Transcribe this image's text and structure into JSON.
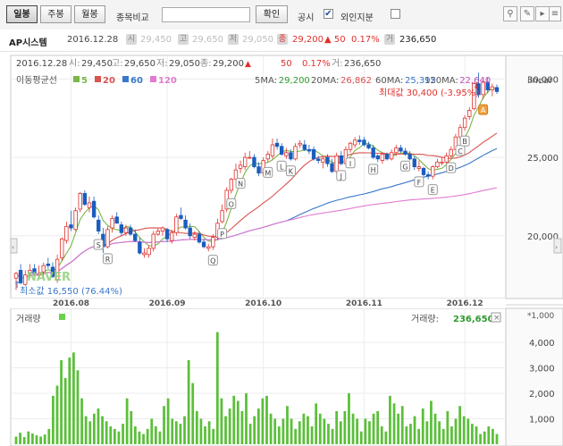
{
  "toolbar": {
    "tabs": [
      {
        "label": "일봉",
        "active": true
      },
      {
        "label": "주봉",
        "active": false
      },
      {
        "label": "월봉",
        "active": false
      }
    ],
    "compare_label": "종목비교",
    "compare_value": "",
    "confirm_label": "확인",
    "notice_label": "공시",
    "notice_checked": true,
    "foreign_label": "외인지분",
    "foreign_checked": false
  },
  "quote": {
    "name": "AP시스템",
    "date": "2016.12.28",
    "open": "29,450",
    "high": "29,650",
    "low": "29,050",
    "close": "29,200",
    "change": "▲ 50",
    "change_pct": "0.17%",
    "volume": "236,650"
  },
  "chart_data": [
    {
      "type": "line",
      "title": "",
      "info_line": {
        "date": "2016.12.28",
        "open_label": "시:",
        "open": "29,450",
        "high_label": "고:",
        "high": "29,650",
        "low_label": "저:",
        "low": "29,050",
        "close_label": "종:",
        "close": "29,200",
        "change_arrow": "▲",
        "change": "50",
        "change_pct": "0.17%",
        "volume_label": "거:",
        "volume": "236,650"
      },
      "legend_title": "이동평균선",
      "legend": [
        {
          "name": "5",
          "color": "#7ab648"
        },
        {
          "name": "20",
          "color": "#d9534f"
        },
        {
          "name": "60",
          "color": "#3a78c9"
        },
        {
          "name": "120",
          "color": "#e27bd0"
        }
      ],
      "ma_values": [
        {
          "label": "5MA:",
          "value": "29,200",
          "color": "#2e9a2e"
        },
        {
          "label": "20MA:",
          "value": "26,862",
          "color": "#d9534f"
        },
        {
          "label": "60MA:",
          "value": "25,395",
          "color": "#3a78c9"
        },
        {
          "label": "120MA:",
          "value": "22,640",
          "color": "#c050b8"
        }
      ],
      "scale_label": "linear",
      "max_label": "최대값 30,400 (-3.95%)",
      "min_label": "최소값 16,550 (76.44%)",
      "watermark": "NAVER",
      "x_ticks": [
        "2016.08",
        "2016.09",
        "2016.10",
        "2016.11",
        "2016.12"
      ],
      "x_tick_index": [
        12,
        33,
        54,
        76,
        98
      ],
      "y_ticks": [
        20000,
        25000,
        30000
      ],
      "y_tick_labels": [
        "20,000",
        "25,000",
        "30,000"
      ],
      "ylim": [
        16000,
        31500
      ],
      "grid": true,
      "candles": {
        "open": [
          17300,
          17800,
          16900,
          17600,
          17900,
          17500,
          17700,
          18200,
          18000,
          17200,
          18600,
          19700,
          20700,
          20400,
          21700,
          22700,
          21800,
          22200,
          21000,
          20100,
          19300,
          20500,
          21200,
          20700,
          20200,
          20500,
          20100,
          19600,
          18800,
          18800,
          19200,
          20100,
          20300,
          20400,
          19700,
          20200,
          21300,
          21000,
          20500,
          19900,
          20100,
          19600,
          19200,
          19300,
          19900,
          20900,
          21700,
          22900,
          23600,
          24300,
          24400,
          25000,
          25000,
          24400,
          24000,
          24900,
          25100,
          25900,
          25700,
          25100,
          25300,
          24900,
          25800,
          25800,
          25500,
          25500,
          24900,
          24700,
          25000,
          24600,
          24100,
          25100,
          24600,
          25500,
          25800,
          26100,
          26100,
          25800,
          25600,
          25100,
          24800,
          25200,
          24900,
          25300,
          25600,
          25400,
          25200,
          24900,
          24300,
          24300,
          23900,
          23800,
          24400,
          24700,
          24700,
          25100,
          25500,
          26300,
          26900,
          27600,
          28100,
          29700,
          29000,
          29800,
          29300,
          29450
        ],
        "high": [
          17700,
          18200,
          17800,
          18200,
          18200,
          18100,
          18300,
          18600,
          18300,
          18800,
          19900,
          20900,
          21600,
          21800,
          22800,
          22900,
          22500,
          22500,
          21300,
          20500,
          20600,
          21300,
          21500,
          20900,
          20700,
          20700,
          20400,
          19900,
          19200,
          19400,
          20300,
          20500,
          20600,
          20500,
          20400,
          21400,
          21800,
          21300,
          20800,
          20300,
          20300,
          19800,
          19500,
          20100,
          21100,
          22000,
          23100,
          23700,
          24600,
          24800,
          25300,
          25400,
          25200,
          24700,
          25000,
          25400,
          26200,
          26200,
          25900,
          25600,
          25500,
          25900,
          26100,
          26100,
          25800,
          25700,
          25100,
          25100,
          25200,
          24900,
          25300,
          25400,
          25700,
          26000,
          26300,
          26400,
          26300,
          26000,
          25800,
          25200,
          25300,
          25300,
          25500,
          25800,
          25800,
          25600,
          25400,
          25100,
          24800,
          24400,
          24100,
          24500,
          24900,
          25000,
          25300,
          25700,
          26500,
          27100,
          27700,
          28200,
          29800,
          30400,
          30000,
          30100,
          29700,
          29650
        ],
        "low": [
          16550,
          16900,
          16800,
          17300,
          17500,
          17400,
          17400,
          17900,
          17300,
          17000,
          18400,
          19500,
          20300,
          20300,
          21500,
          21900,
          21500,
          21100,
          20100,
          18900,
          19200,
          20200,
          20800,
          20000,
          20000,
          20000,
          19600,
          18800,
          18600,
          18600,
          19000,
          20000,
          20000,
          19600,
          19500,
          20000,
          21000,
          20400,
          19800,
          19700,
          19500,
          19200,
          19000,
          19100,
          19700,
          20800,
          21500,
          22700,
          23500,
          24000,
          24200,
          24900,
          24300,
          23800,
          23800,
          24700,
          24900,
          25500,
          25100,
          24900,
          24800,
          24800,
          25600,
          25400,
          25200,
          24800,
          24600,
          24300,
          24400,
          24000,
          24000,
          24500,
          24500,
          25300,
          25600,
          25800,
          25700,
          25500,
          24900,
          24700,
          24600,
          24800,
          24800,
          25100,
          25300,
          25100,
          24800,
          24200,
          24100,
          23800,
          23600,
          23600,
          24300,
          24500,
          24600,
          25000,
          25400,
          26100,
          26700,
          27400,
          28000,
          28800,
          28700,
          29100,
          28900,
          29050
        ],
        "close": [
          17600,
          17000,
          17500,
          17800,
          17600,
          17600,
          18100,
          18100,
          17400,
          18500,
          19800,
          20600,
          20500,
          21600,
          22700,
          22000,
          22100,
          21200,
          20300,
          19300,
          20400,
          21100,
          20800,
          20200,
          20500,
          20100,
          19700,
          18900,
          18900,
          19200,
          20100,
          20300,
          20500,
          19800,
          20200,
          21200,
          21100,
          20500,
          20000,
          20100,
          19600,
          19300,
          19300,
          19900,
          20800,
          21600,
          22900,
          23600,
          24200,
          24500,
          25000,
          25000,
          24400,
          24000,
          24800,
          25200,
          25800,
          25700,
          25200,
          25300,
          24900,
          25700,
          25900,
          25500,
          25400,
          24900,
          24800,
          24900,
          24600,
          24100,
          25100,
          24600,
          25500,
          25900,
          26100,
          26000,
          25800,
          25600,
          25000,
          24900,
          25200,
          24900,
          25300,
          25600,
          25400,
          25200,
          24900,
          24400,
          24400,
          23900,
          23800,
          24400,
          24700,
          24700,
          25100,
          25500,
          26300,
          26900,
          27500,
          28000,
          29700,
          29000,
          29800,
          29300,
          29500,
          29200
        ]
      },
      "annotations": [
        {
          "i": 22,
          "letter": "S",
          "side": "below"
        },
        {
          "i": 24,
          "letter": "R",
          "side": "below"
        },
        {
          "i": 51,
          "letter": "Q",
          "side": "below"
        },
        {
          "i": 54,
          "letter": "P",
          "side": "below"
        },
        {
          "i": 56,
          "letter": "O",
          "side": "below"
        },
        {
          "i": 58,
          "letter": "N",
          "side": "below"
        },
        {
          "i": 65,
          "letter": "M",
          "side": "below"
        },
        {
          "i": 69,
          "letter": "L",
          "side": "below"
        },
        {
          "i": 71,
          "letter": "K",
          "side": "below"
        },
        {
          "i": 85,
          "letter": "J",
          "side": "below"
        },
        {
          "i": 87,
          "letter": "I",
          "side": "below"
        },
        {
          "i": 93,
          "letter": "H",
          "side": "below"
        },
        {
          "i": 101,
          "letter": "G",
          "side": "below"
        },
        {
          "i": 105,
          "letter": "F",
          "side": "below"
        },
        {
          "i": 108,
          "letter": "E",
          "side": "below"
        },
        {
          "i": 113,
          "letter": "D",
          "side": "below"
        },
        {
          "i": 115,
          "letter": "C",
          "side": "below"
        },
        {
          "i": 117,
          "letter": "B",
          "side": "below"
        },
        {
          "i": 122,
          "letter": "A",
          "side": "below"
        }
      ]
    },
    {
      "type": "bar",
      "title": "거래량",
      "value_label": "거래량:",
      "value": "236,650",
      "unit_label": "*1,000",
      "y_ticks": [
        1000,
        2000,
        3000,
        4000
      ],
      "y_tick_labels": [
        "1,000",
        "2,000",
        "3,000",
        "4,000"
      ],
      "ylim": [
        0,
        4700
      ],
      "values": [
        300,
        450,
        280,
        500,
        420,
        350,
        300,
        380,
        600,
        1900,
        2300,
        3300,
        2600,
        3400,
        3600,
        2900,
        1800,
        1100,
        900,
        1200,
        1400,
        1100,
        900,
        700,
        600,
        500,
        800,
        1800,
        1300,
        700,
        500,
        400,
        600,
        1000,
        700,
        500,
        1500,
        1800,
        1000,
        900,
        800,
        1100,
        3300,
        2400,
        1300,
        1000,
        700,
        900,
        600,
        4400,
        1800,
        1100,
        1400,
        1900,
        1700,
        1300,
        2000,
        800,
        1100,
        1400,
        1800,
        1900,
        1200,
        1000,
        700,
        1000,
        1500,
        1000,
        600,
        900,
        1200,
        1100,
        700,
        1600,
        1200,
        1000,
        800,
        600,
        1300,
        900,
        1300,
        2000,
        1200,
        1000,
        500,
        1000,
        900,
        1200,
        1300,
        700,
        500,
        1900,
        1600,
        1200,
        1500,
        700,
        800,
        1100,
        600,
        1400,
        900,
        1700,
        1200,
        900,
        600,
        1300,
        700,
        1000,
        1500,
        1100,
        1000,
        800,
        700,
        400,
        500,
        700,
        600,
        400
      ]
    }
  ]
}
